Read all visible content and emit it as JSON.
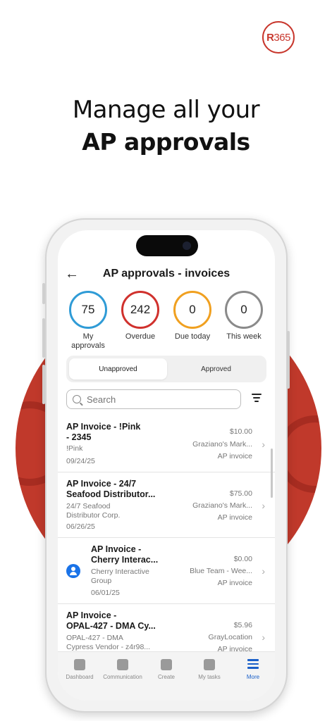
{
  "brand": {
    "logo_bold": "R",
    "logo_thin": "365",
    "accent": "#c8372d"
  },
  "headline": {
    "line1": "Manage all your",
    "line2": "AP approvals"
  },
  "app": {
    "title": "AP approvals - invoices",
    "stats": [
      {
        "value": "75",
        "label": "My\napprovals",
        "color": "#2f9bd6"
      },
      {
        "value": "242",
        "label": "Overdue",
        "color": "#d0312d"
      },
      {
        "value": "0",
        "label": "Due today",
        "color": "#f0a020"
      },
      {
        "value": "0",
        "label": "This week",
        "color": "#8a8a8a"
      }
    ],
    "segments": {
      "active": "Unapproved",
      "inactive": "Approved"
    },
    "search": {
      "placeholder": "Search"
    },
    "items": [
      {
        "title": "AP Invoice - !Pink\n- 2345",
        "sub": "!Pink",
        "date": "09/24/25",
        "amount": "$10.00",
        "vendor": "Graziano's Mark...",
        "type": "AP invoice"
      },
      {
        "title": "AP Invoice - 24/7\nSeafood Distributor...",
        "sub": "24/7 Seafood\nDistributor Corp.",
        "date": "06/26/25",
        "amount": "$75.00",
        "vendor": "Graziano's Mark...",
        "type": "AP invoice"
      },
      {
        "title": "AP Invoice -\nCherry Interac...",
        "sub": "Cherry Interactive\nGroup",
        "date": "06/01/25",
        "amount": "$0.00",
        "vendor": "Blue Team - Wee...",
        "type": "AP invoice"
      },
      {
        "title": "AP Invoice -\nOPAL-427 - DMA Cy...",
        "sub": "OPAL-427 - DMA\nCypress Vendor - z4r98...",
        "date": "",
        "amount": "$5.96",
        "vendor": "GrayLocation",
        "type": "AP invoice"
      }
    ],
    "tabs": [
      {
        "label": "Dashboard",
        "icon": "grid-icon"
      },
      {
        "label": "Communication",
        "icon": "chat-icon"
      },
      {
        "label": "Create",
        "icon": "plus-icon"
      },
      {
        "label": "My tasks",
        "icon": "tasks-icon"
      },
      {
        "label": "More",
        "icon": "menu-icon"
      }
    ]
  }
}
